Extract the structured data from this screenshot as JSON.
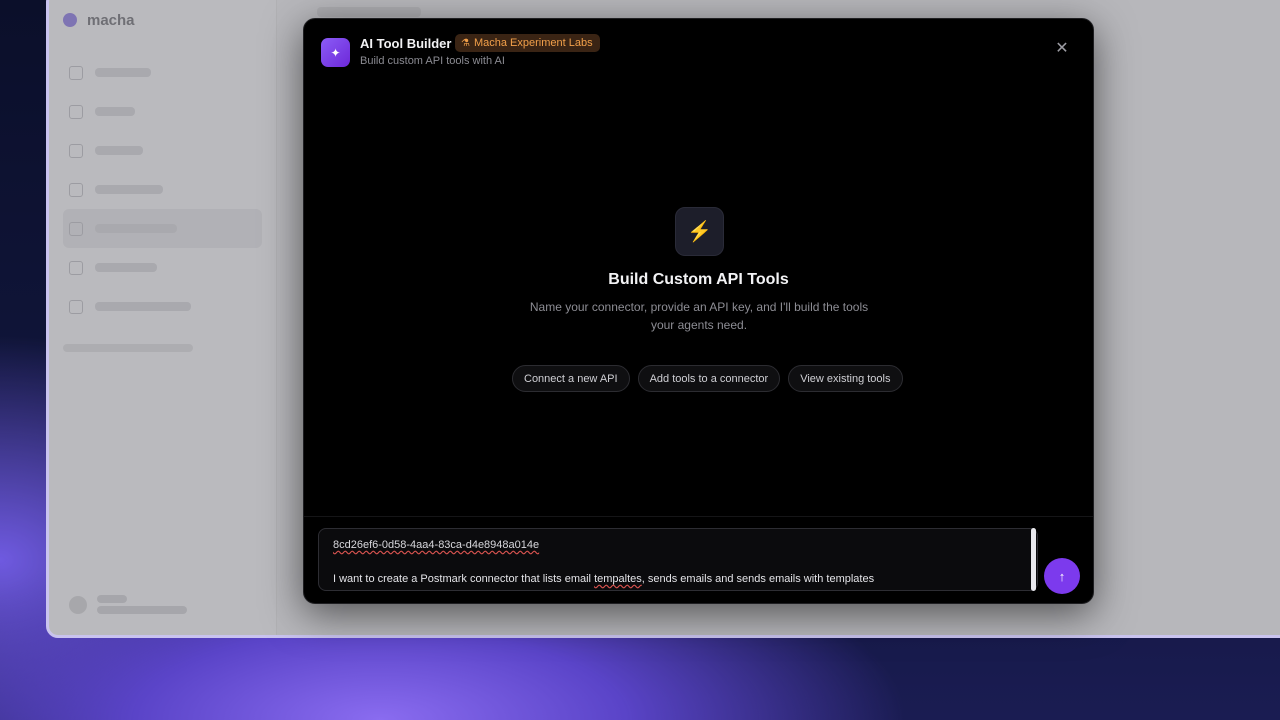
{
  "background_app": {
    "brand_name": "macha"
  },
  "modal": {
    "title": "AI Tool Builder",
    "subtitle": "Build custom API tools with AI",
    "badge": "Macha Experiment Labs",
    "badge_icon": "flask-icon",
    "close_icon": "close-icon",
    "hero": {
      "icon": "lightning-icon",
      "title": "Build Custom API Tools",
      "description": "Name your connector, provide an API key, and I'll build the tools your agents need."
    },
    "suggestions": [
      "Connect a new API",
      "Add tools to a connector",
      "View existing tools"
    ],
    "composer": {
      "line1": "8cd26ef6-0d58-4aa4-83ca-d4e8948a014e",
      "line2_part1": "I want to create a Postmark connector that lists email ",
      "line2_misspelled": "tempaltes",
      "line2_part2": ", sends emails and sends emails with templates",
      "send_icon": "arrow-up-icon"
    }
  },
  "colors": {
    "accent": "#7c3aed",
    "badge_text": "#f2a04a",
    "modal_bg": "#000000"
  }
}
